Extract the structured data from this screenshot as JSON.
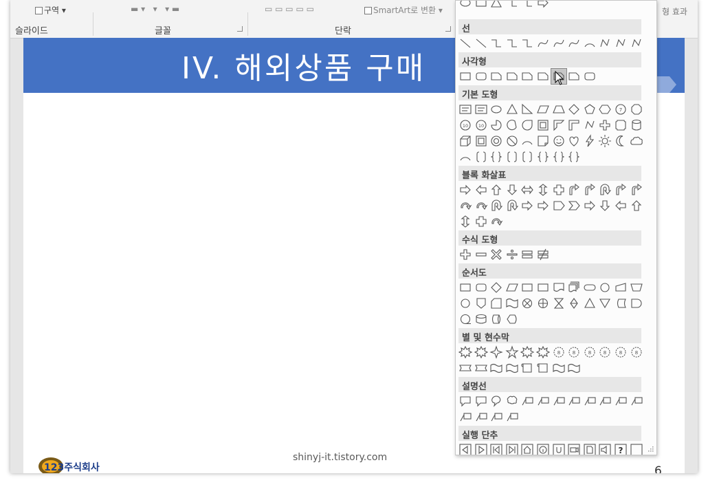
{
  "ribbon": {
    "top_left_label": "구역",
    "smartart_label": "SmartArt로 변환",
    "right_clip": "형 효과",
    "groups": [
      "슬라이드",
      "글꼴",
      "단락"
    ]
  },
  "slide": {
    "title": "IV. 해외상품 구매",
    "footer": "shinyj-it.tistory.com",
    "page_number": "6",
    "logo_text": "123주식회사",
    "title_color": "#4472C4"
  },
  "shape_gallery": {
    "categories": [
      {
        "label": "선",
        "rows": [
          12
        ]
      },
      {
        "label": "사각형",
        "rows": [
          9
        ]
      },
      {
        "label": "기본 도형",
        "rows": [
          12,
          12,
          12,
          8
        ]
      },
      {
        "label": "블록 화살표",
        "rows": [
          12,
          12,
          3
        ]
      },
      {
        "label": "수식 도형",
        "rows": [
          6
        ]
      },
      {
        "label": "순서도",
        "rows": [
          12,
          12,
          4
        ]
      },
      {
        "label": "별 및 현수막",
        "rows": [
          12,
          8
        ]
      },
      {
        "label": "설명선",
        "rows": [
          12,
          4
        ]
      },
      {
        "label": "실행 단추",
        "rows": [
          12
        ]
      }
    ],
    "top_clipped_row": 6,
    "hovered_shape": "snip-rectangle",
    "question_glyph": "?"
  }
}
